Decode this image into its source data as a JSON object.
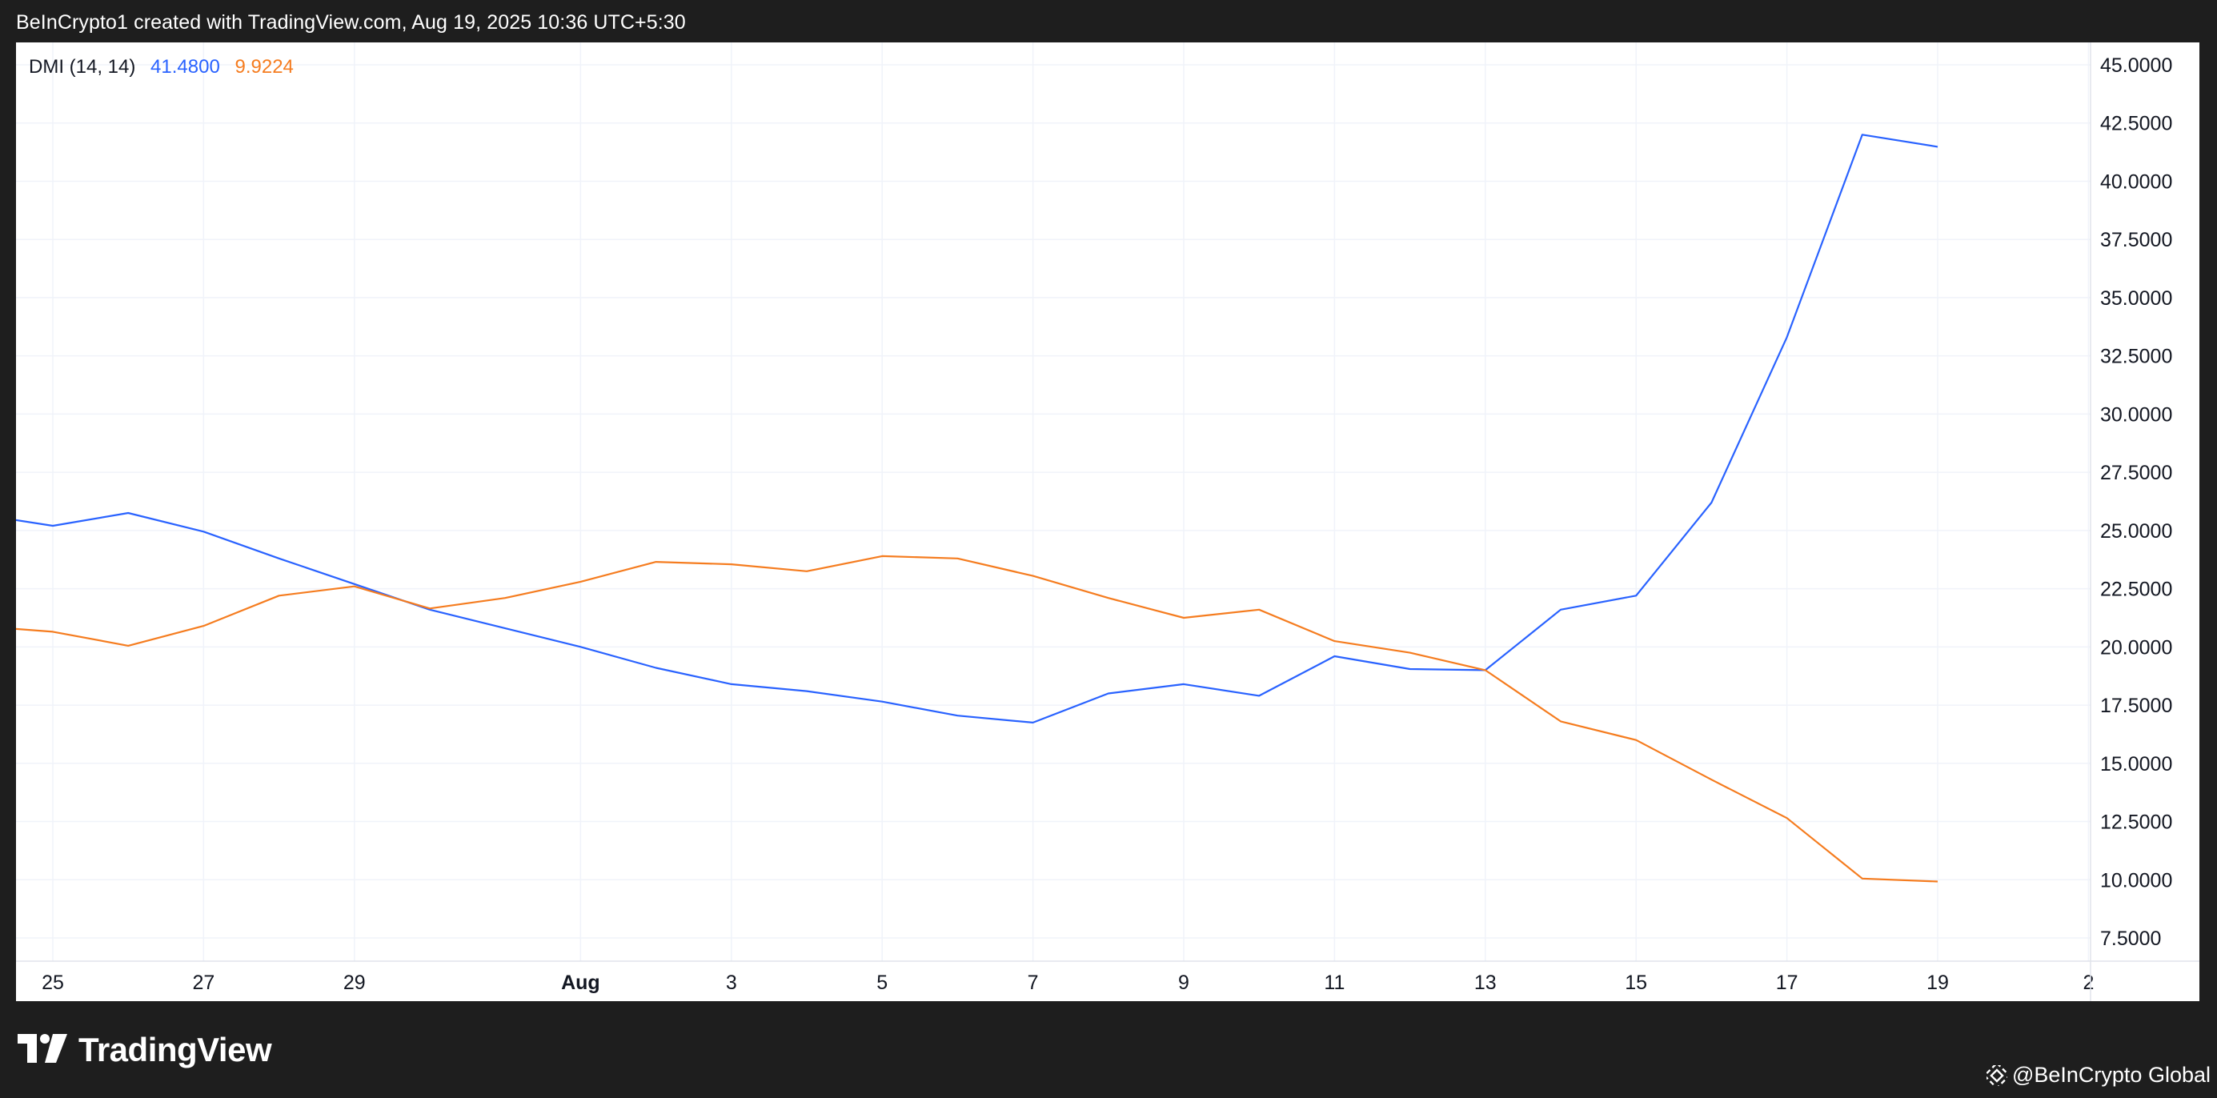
{
  "header": {
    "caption": "BeInCrypto1 created with TradingView.com, Aug 19, 2025 10:36 UTC+5:30"
  },
  "footer": {
    "logo_text": "TradingView",
    "watermark": "@BeInCrypto Global"
  },
  "colors": {
    "background": "#1e1e1e",
    "panel": "#ffffff",
    "plus_di": "#2962ff",
    "minus_di": "#f57c1f",
    "grid": "#f0f3fa",
    "text": "#131722"
  },
  "chart_data": {
    "type": "line",
    "legend": {
      "name": "DMI (14, 14)",
      "value1": "41.4800",
      "value2": "9.9224"
    },
    "x": [
      "Jul 24",
      "Jul 25",
      "Jul 26",
      "Jul 27",
      "Jul 28",
      "Jul 29",
      "Jul 30",
      "Jul 31",
      "Aug 1",
      "Aug 2",
      "Aug 3",
      "Aug 4",
      "Aug 5",
      "Aug 6",
      "Aug 7",
      "Aug 8",
      "Aug 9",
      "Aug 10",
      "Aug 11",
      "Aug 12",
      "Aug 13",
      "Aug 14",
      "Aug 15",
      "Aug 16",
      "Aug 17",
      "Aug 18",
      "Aug 19"
    ],
    "x_ticks": [
      {
        "index": 1,
        "label": "25",
        "bold": false
      },
      {
        "index": 3,
        "label": "27",
        "bold": false
      },
      {
        "index": 5,
        "label": "29",
        "bold": false
      },
      {
        "index": 8,
        "label": "Aug",
        "bold": true
      },
      {
        "index": 10,
        "label": "3",
        "bold": false
      },
      {
        "index": 12,
        "label": "5",
        "bold": false
      },
      {
        "index": 14,
        "label": "7",
        "bold": false
      },
      {
        "index": 16,
        "label": "9",
        "bold": false
      },
      {
        "index": 18,
        "label": "11",
        "bold": false
      },
      {
        "index": 20,
        "label": "13",
        "bold": false
      },
      {
        "index": 22,
        "label": "15",
        "bold": false
      },
      {
        "index": 24,
        "label": "17",
        "bold": false
      },
      {
        "index": 26,
        "label": "19",
        "bold": false
      },
      {
        "index": 28,
        "label": "2",
        "bold": false
      }
    ],
    "series": [
      {
        "color": "#2962ff",
        "values": [
          25.7,
          25.2,
          25.75,
          24.95,
          23.8,
          22.7,
          21.6,
          20.8,
          20.0,
          19.1,
          18.4,
          18.1,
          17.65,
          17.05,
          16.75,
          18.0,
          18.4,
          17.9,
          19.6,
          19.05,
          19.0,
          21.6,
          22.2,
          26.2,
          33.3,
          42.0,
          41.48
        ]
      },
      {
        "color": "#f57c1f",
        "values": [
          20.9,
          20.65,
          20.05,
          20.9,
          22.2,
          22.6,
          21.65,
          22.1,
          22.8,
          23.65,
          23.55,
          23.25,
          23.9,
          23.8,
          23.05,
          22.1,
          21.25,
          21.6,
          20.25,
          19.75,
          19.0,
          16.8,
          16.0,
          14.3,
          12.65,
          10.05,
          9.9224
        ]
      }
    ],
    "y_ticks": [
      "45.0000",
      "42.5000",
      "40.0000",
      "37.5000",
      "35.0000",
      "32.5000",
      "30.0000",
      "27.5000",
      "25.0000",
      "22.5000",
      "20.0000",
      "17.5000",
      "15.0000",
      "12.5000",
      "10.0000",
      "7.5000"
    ],
    "ylim": [
      7.5,
      45.0
    ],
    "grid": true
  }
}
